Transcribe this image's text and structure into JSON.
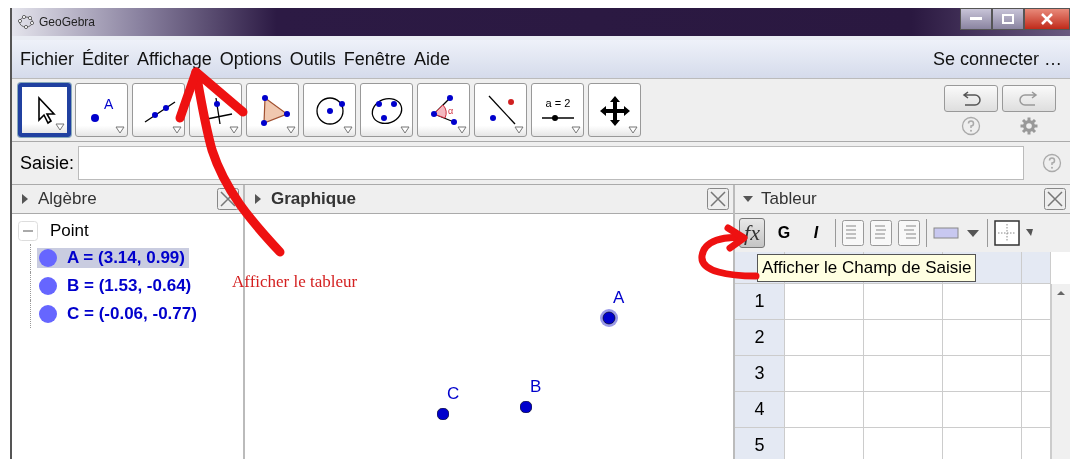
{
  "window": {
    "title": "GeoGebra"
  },
  "menu": [
    "Fichier",
    "Éditer",
    "Affichage",
    "Options",
    "Outils",
    "Fenêtre",
    "Aide"
  ],
  "account": "Se connecter …",
  "toolbar": {
    "tools": [
      {
        "kind": "move",
        "selected": true
      },
      {
        "kind": "point",
        "label": "A",
        "selected": false
      },
      {
        "kind": "line",
        "selected": false
      },
      {
        "kind": "perpendicular",
        "selected": false
      },
      {
        "kind": "polygon",
        "selected": false
      },
      {
        "kind": "circle",
        "selected": false
      },
      {
        "kind": "conic",
        "selected": false
      },
      {
        "kind": "angle",
        "label": "α",
        "selected": false
      },
      {
        "kind": "reflect",
        "selected": false
      },
      {
        "kind": "slider",
        "label": "a = 2",
        "selected": false
      },
      {
        "kind": "move_view",
        "selected": false
      }
    ]
  },
  "input_bar": {
    "label": "Saisie:"
  },
  "algebra": {
    "title": "Algèbre",
    "expanded": false,
    "tree": [
      {
        "label": "Point",
        "expanded": true,
        "children": [
          {
            "label": "A = (3.14, 0.99)",
            "selected": true
          },
          {
            "label": "B = (1.53, -0.64)",
            "selected": false
          },
          {
            "label": "C = (-0.06, -0.77)",
            "selected": false
          }
        ]
      }
    ]
  },
  "graphics": {
    "title": "Graphique",
    "expanded": false,
    "points": [
      {
        "label": "A",
        "selected": true
      },
      {
        "label": "B",
        "selected": false
      },
      {
        "label": "C",
        "selected": false
      }
    ]
  },
  "spreadsheet": {
    "title": "Tableur",
    "expanded": true,
    "style_bar": [
      {
        "kind": "formula",
        "label": "fx",
        "selected": true
      },
      {
        "kind": "bold",
        "label": "G",
        "selected": false
      },
      {
        "kind": "italic",
        "label": "I",
        "selected": false
      },
      {
        "kind": "align_left"
      },
      {
        "kind": "align_center"
      },
      {
        "kind": "align_right"
      },
      {
        "kind": "bg_color"
      },
      {
        "kind": "border"
      }
    ],
    "tooltip": "Afficher le Champ de Saisie",
    "rows": [
      "1",
      "2",
      "3",
      "4",
      "5"
    ]
  },
  "annotation": "Afficher le tableur"
}
